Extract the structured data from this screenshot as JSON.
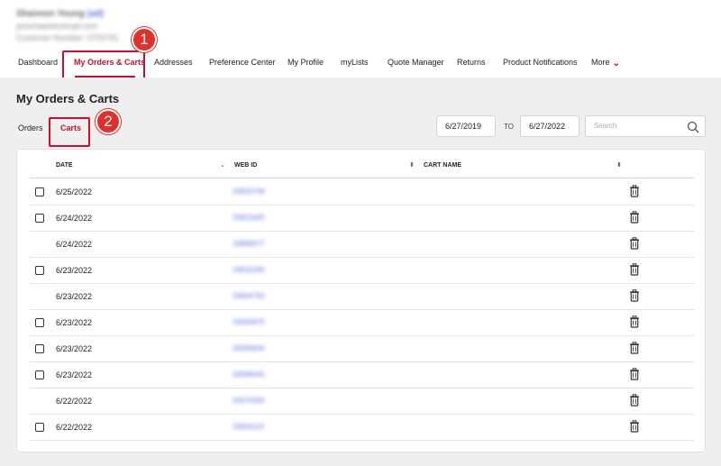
{
  "user": {
    "name": "Shannon Young",
    "tag": "(ad)",
    "email": "jsmichaelshotmail.com",
    "customer": "Customer Number: 0700791"
  },
  "nav": {
    "items": [
      {
        "label": "Dashboard"
      },
      {
        "label": "My Orders & Carts"
      },
      {
        "label": "Addresses"
      },
      {
        "label": "Preference Center"
      },
      {
        "label": "My Profile"
      },
      {
        "label": "myLists"
      },
      {
        "label": "Quote Manager"
      },
      {
        "label": "Returns"
      },
      {
        "label": "Product Notifications"
      },
      {
        "label": "More"
      }
    ],
    "more_icon": "chevron-down-icon"
  },
  "callouts": {
    "first": "1",
    "second": "2"
  },
  "page": {
    "title": "My Orders & Carts",
    "tabs": [
      {
        "label": "Orders"
      },
      {
        "label": "Carts"
      }
    ],
    "date_from": "6/27/2019",
    "to_label": "TO",
    "date_to": "6/27/2022",
    "search_placeholder": "Search"
  },
  "table": {
    "columns": [
      {
        "label": "DATE",
        "sort_icon": "sort-desc-icon"
      },
      {
        "label": "WEB ID",
        "sort_icon": "sort-icon"
      },
      {
        "label": "CART NAME",
        "sort_icon": "sort-icon"
      }
    ],
    "rows": [
      {
        "date": "6/25/2022",
        "web_id": "33920758",
        "checkbox": true
      },
      {
        "date": "6/24/2022",
        "web_id": "33815405",
        "checkbox": true
      },
      {
        "date": "6/24/2022",
        "web_id": "33899977",
        "checkbox": false
      },
      {
        "date": "6/23/2022",
        "web_id": "33632290",
        "checkbox": true
      },
      {
        "date": "6/23/2022",
        "web_id": "33604740",
        "checkbox": false
      },
      {
        "date": "6/23/2022",
        "web_id": "33693975",
        "checkbox": true
      },
      {
        "date": "6/23/2022",
        "web_id": "33590834",
        "checkbox": true
      },
      {
        "date": "6/23/2022",
        "web_id": "33586505",
        "checkbox": true
      },
      {
        "date": "6/22/2022",
        "web_id": "33475583",
        "checkbox": false
      },
      {
        "date": "6/22/2022",
        "web_id": "33505113",
        "checkbox": true
      }
    ],
    "row_icon": "trash-icon"
  },
  "colors": {
    "accent": "#c8102e",
    "link": "#5b6fd8",
    "background": "#efefef"
  }
}
